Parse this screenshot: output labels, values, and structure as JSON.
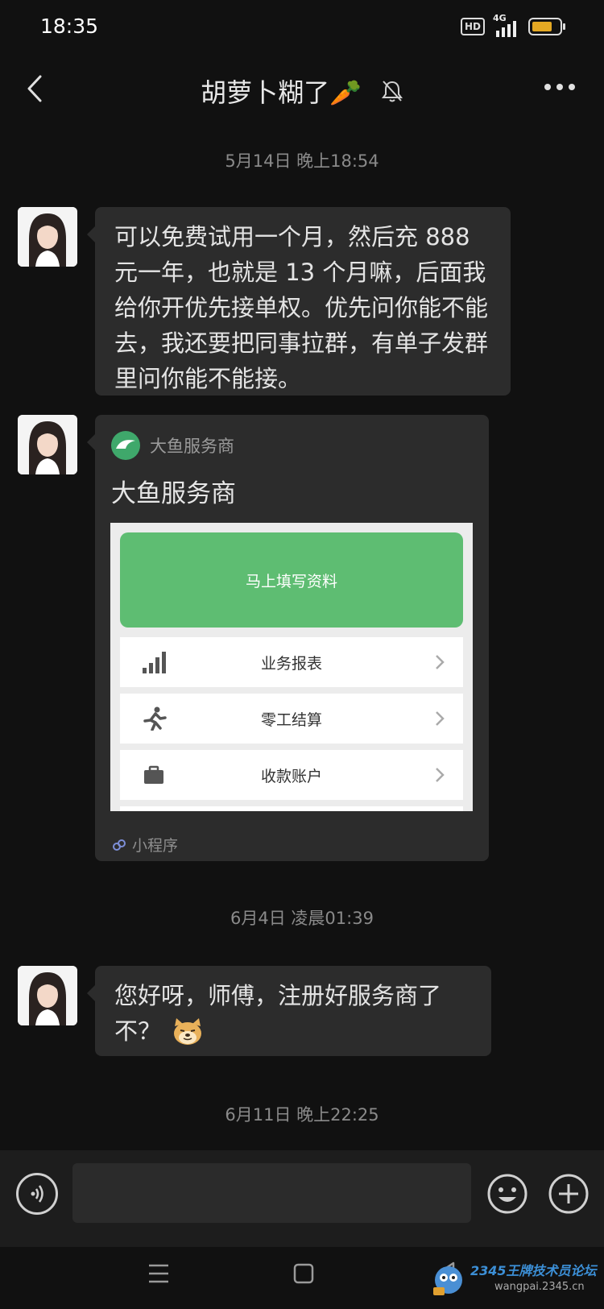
{
  "status_bar": {
    "time": "18:35",
    "hd_badge": "HD",
    "network": "4G",
    "battery_color": "#e4a823",
    "battery_level": 0.75
  },
  "header": {
    "title": "胡萝卜糊了🥕",
    "muted_icon": "bell-mute-icon",
    "more_icon": "more-dots-icon",
    "back_icon": "chevron-left-icon"
  },
  "messages": [
    {
      "type": "timestamp",
      "text": "5月14日 晚上18:54"
    },
    {
      "type": "text",
      "sender": "other",
      "text": "可以免费试用一个月，然后充 888 元一年，也就是 13 个月嘛，后面我给你开优先接单权。优先问你能不能去，我还要把同事拉群，有单子发群里问你能不能接。"
    },
    {
      "type": "mini_program",
      "sender": "other",
      "source": "大鱼服务商",
      "title": "大鱼服务商",
      "preview": {
        "cta": "马上填写资料",
        "rows": [
          {
            "icon": "bar-chart-icon",
            "label": "业务报表"
          },
          {
            "icon": "running-person-icon",
            "label": "零工结算"
          },
          {
            "icon": "wallet-icon",
            "label": "收款账户"
          }
        ]
      },
      "footer": "小程序"
    },
    {
      "type": "timestamp",
      "text": "6月4日 凌晨01:39"
    },
    {
      "type": "text",
      "sender": "other",
      "text": "您好呀，师傅，注册好服务商了不？",
      "emoji": "doge-emoji"
    },
    {
      "type": "timestamp",
      "text": "6月11日 晚上22:25"
    }
  ],
  "input_bar": {
    "voice_icon": "voice-icon",
    "input_value": "",
    "emoji_icon": "emoji-smile-icon",
    "plus_icon": "plus-icon"
  },
  "system_nav": {
    "menu_icon": "menu-icon",
    "home_icon": "home-icon",
    "back_icon": "back-triangle-icon"
  },
  "watermark": {
    "title": "2345王牌技术员论坛",
    "url": "wangpai.2345.cn"
  },
  "colors": {
    "background": "#111111",
    "bubble": "#2c2c2c",
    "accent_green": "#5ebd72"
  }
}
